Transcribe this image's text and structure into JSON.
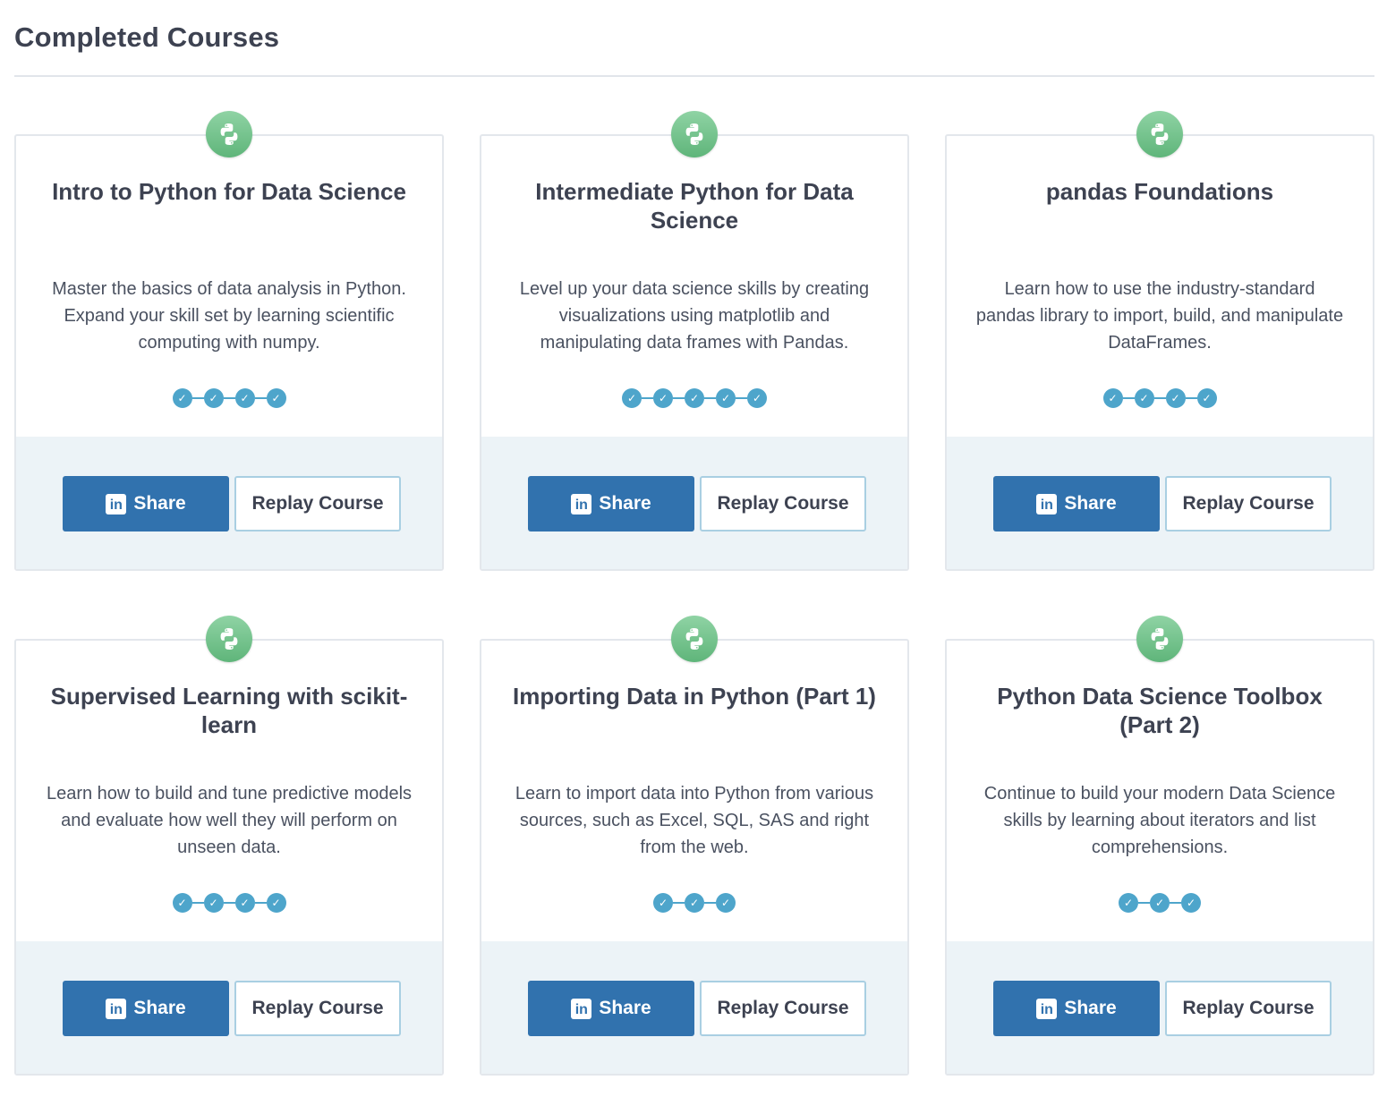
{
  "page": {
    "title": "Completed Courses"
  },
  "colors": {
    "share_button": "#3172ae",
    "progress_dot": "#4ea5cb",
    "badge_green": "#6cc08a",
    "card_footer": "#ecf3f7"
  },
  "courses": [
    {
      "title": "Intro to Python for Data Science",
      "description": "Master the basics of data analysis in Python. Expand your skill set by learning scientific computing with numpy.",
      "chapters_completed": 4,
      "icon": "python-icon",
      "share_label": "Share",
      "replay_label": "Replay Course"
    },
    {
      "title": "Intermediate Python for Data Science",
      "description": "Level up your data science skills by creating visualizations using matplotlib and manipulating data frames with Pandas.",
      "chapters_completed": 5,
      "icon": "python-icon",
      "share_label": "Share",
      "replay_label": "Replay Course"
    },
    {
      "title": "pandas Foundations",
      "description": "Learn how to use the industry-standard pandas library to import, build, and manipulate DataFrames.",
      "chapters_completed": 4,
      "icon": "python-icon",
      "share_label": "Share",
      "replay_label": "Replay Course"
    },
    {
      "title": "Supervised Learning with scikit-learn",
      "description": "Learn how to build and tune predictive models and evaluate how well they will perform on unseen data.",
      "chapters_completed": 4,
      "icon": "python-icon",
      "share_label": "Share",
      "replay_label": "Replay Course"
    },
    {
      "title": "Importing Data in Python (Part 1)",
      "description": "Learn to import data into Python from various sources, such as Excel, SQL, SAS and right from the web.",
      "chapters_completed": 3,
      "icon": "python-icon",
      "share_label": "Share",
      "replay_label": "Replay Course"
    },
    {
      "title": "Python Data Science Toolbox (Part 2)",
      "description": "Continue to build your modern Data Science skills by learning about iterators and list comprehensions.",
      "chapters_completed": 3,
      "icon": "python-icon",
      "share_label": "Share",
      "replay_label": "Replay Course"
    }
  ]
}
